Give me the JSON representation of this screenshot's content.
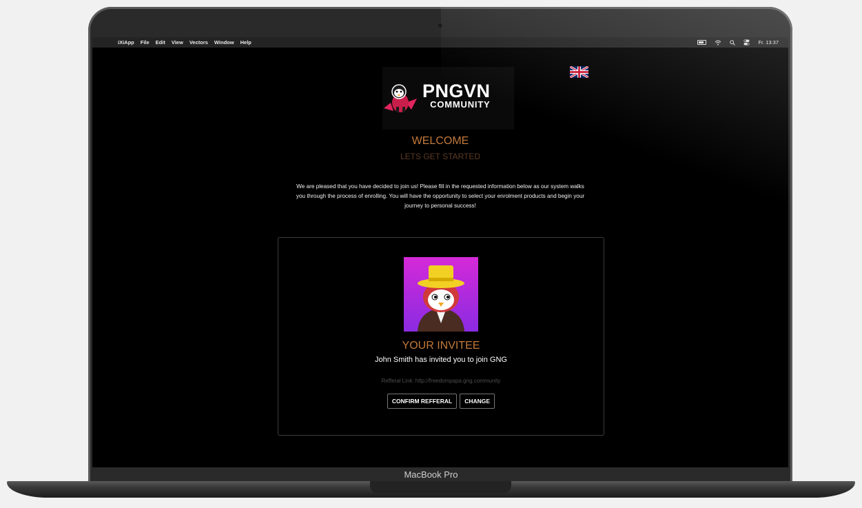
{
  "menubar": {
    "apple": "",
    "items": [
      "iXiApp",
      "File",
      "Edit",
      "View",
      "Vectors",
      "Window",
      "Help"
    ],
    "clock": "Fr. 13:37"
  },
  "logo": {
    "main": "PNGVN",
    "sub": "COMMUNITY"
  },
  "language_flag": "uk-flag-icon",
  "welcome": {
    "title": "WELCOME",
    "subtitle": "LETS GET STARTED"
  },
  "intro": {
    "line1": "We are pleased that you have decided to join us! Please fill in the requested information below as our system walks",
    "line2": "you through the process of enrolling. You will have the opportunity to select your enrolment products and begin your",
    "line3": "journey to personal success!"
  },
  "invitee": {
    "title": "YOUR INVITEE",
    "message": "John Smith has invited you to join GNG",
    "referral_link": "Refferal Link: http://freedompapa.gng.community",
    "confirm_label": "CONFIRM REFFERAL",
    "change_label": "CHANGE"
  },
  "device_label": "MacBook Pro",
  "colors": {
    "accent": "#c47a3a",
    "accent_dim": "#5c3a22",
    "background": "#000000"
  }
}
